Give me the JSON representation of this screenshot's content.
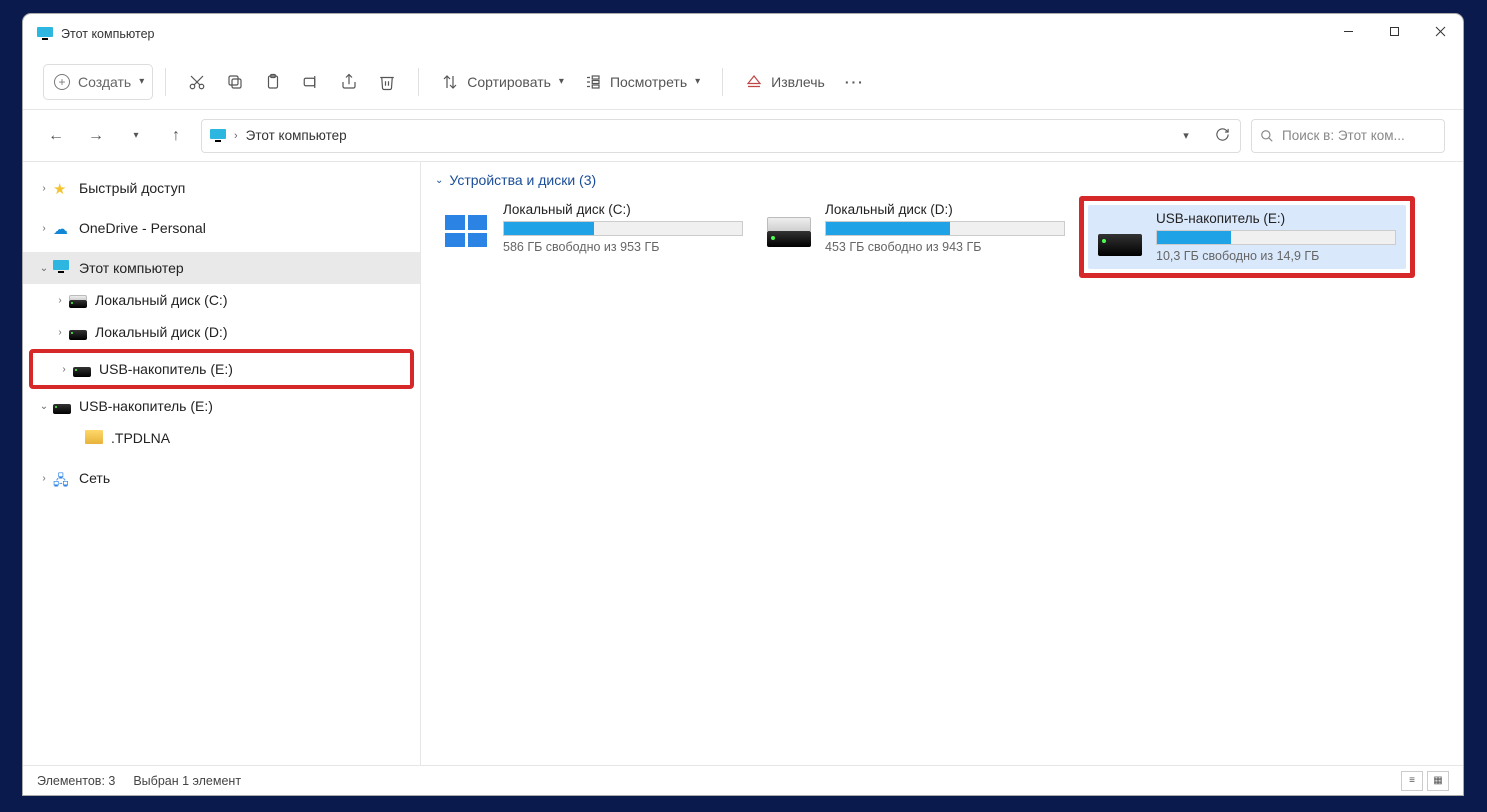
{
  "window": {
    "title": "Этот компьютер"
  },
  "toolbar": {
    "create": "Создать",
    "sort": "Сортировать",
    "view": "Посмотреть",
    "eject": "Извлечь"
  },
  "breadcrumb": {
    "root": "Этот компьютер"
  },
  "search": {
    "placeholder": "Поиск в: Этот ком..."
  },
  "sidebar": {
    "quick": "Быстрый доступ",
    "onedrive": "OneDrive - Personal",
    "thispc": "Этот компьютер",
    "disk_c": "Локальный диск (C:)",
    "disk_d": "Локальный диск (D:)",
    "usb_e1": "USB-накопитель (E:)",
    "usb_e2": "USB-накопитель (E:)",
    "tpdlna": ".TPDLNA",
    "network": "Сеть"
  },
  "group": {
    "label": "Устройства и диски (3)"
  },
  "drives": [
    {
      "name": "Локальный диск (C:)",
      "info": "586 ГБ свободно из 953 ГБ",
      "fill_pct": 38,
      "type": "os"
    },
    {
      "name": "Локальный диск (D:)",
      "info": "453 ГБ свободно из 943 ГБ",
      "fill_pct": 52,
      "type": "hdd"
    },
    {
      "name": "USB-накопитель (E:)",
      "info": "10,3 ГБ свободно из 14,9 ГБ",
      "fill_pct": 31,
      "type": "usb",
      "selected": true,
      "highlighted": true
    }
  ],
  "status": {
    "items": "Элементов: 3",
    "selected": "Выбран 1 элемент"
  }
}
